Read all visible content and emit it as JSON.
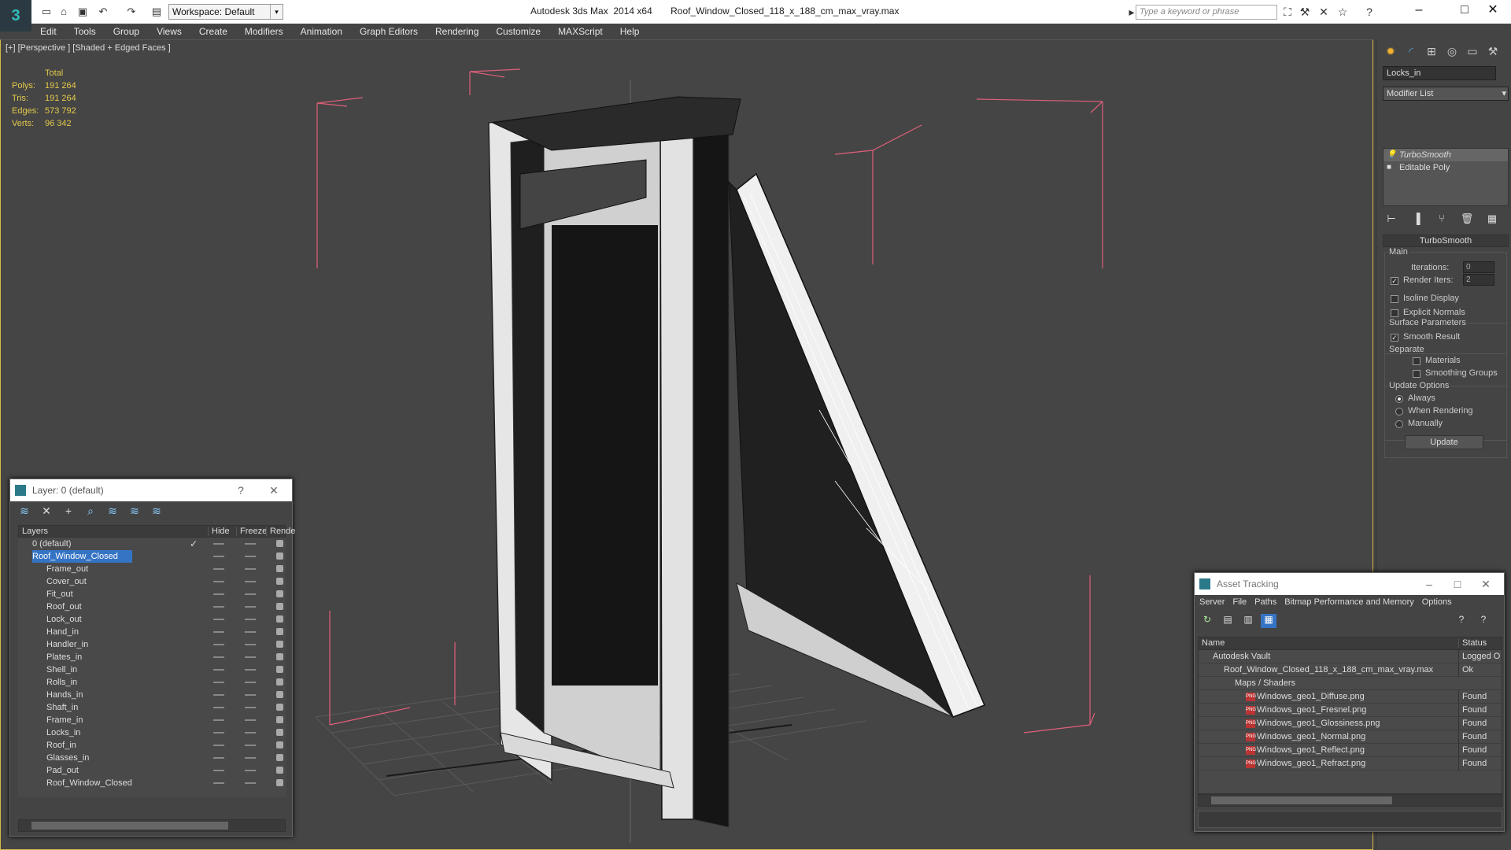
{
  "window": {
    "title": "Autodesk 3ds Max  2014 x64       Roof_Window_Closed_118_x_188_cm_max_vray.max",
    "workspace": "Workspace: Default",
    "search_placeholder": "Type a keyword or phrase"
  },
  "menu": [
    "Edit",
    "Tools",
    "Group",
    "Views",
    "Create",
    "Modifiers",
    "Animation",
    "Graph Editors",
    "Rendering",
    "Customize",
    "MAXScript",
    "Help"
  ],
  "viewport": {
    "label": "[+] [Perspective ] [Shaded + Edged Faces ]",
    "stats_header": "Total",
    "stats": [
      {
        "label": "Polys:",
        "value": "191 264"
      },
      {
        "label": "Tris:",
        "value": "191 264"
      },
      {
        "label": "Edges:",
        "value": "573 792"
      },
      {
        "label": "Verts:",
        "value": "96 342"
      }
    ]
  },
  "command_panel": {
    "object_name": "Locks_in",
    "modifier_list": "Modifier List",
    "stack": [
      "TurboSmooth",
      "Editable Poly"
    ],
    "rollout_title": "TurboSmooth",
    "main_label": "Main",
    "iterations_label": "Iterations:",
    "iterations_value": "0",
    "render_iters_label": "Render Iters:",
    "render_iters_value": "2",
    "isoline": "Isoline Display",
    "explicit": "Explicit Normals",
    "surface_params": "Surface Parameters",
    "smooth_result": "Smooth Result",
    "separate": "Separate",
    "materials": "Materials",
    "smoothing_groups": "Smoothing Groups",
    "update_options": "Update Options",
    "always": "Always",
    "when_rendering": "When Rendering",
    "manually": "Manually",
    "update_btn": "Update"
  },
  "layer_dialog": {
    "title": "Layer: 0 (default)",
    "help": "?",
    "columns": {
      "layers": "Layers",
      "hide": "Hide",
      "freeze": "Freeze",
      "render": "Rende"
    },
    "rows": [
      {
        "name": "0 (default)",
        "indent": 0
      },
      {
        "name": "Roof_Window_Closed",
        "indent": 0
      },
      {
        "name": "Frame_out",
        "indent": 1
      },
      {
        "name": "Cover_out",
        "indent": 1
      },
      {
        "name": "Fit_out",
        "indent": 1
      },
      {
        "name": "Roof_out",
        "indent": 1
      },
      {
        "name": "Lock_out",
        "indent": 1
      },
      {
        "name": "Hand_in",
        "indent": 1
      },
      {
        "name": "Handler_in",
        "indent": 1
      },
      {
        "name": "Plates_in",
        "indent": 1
      },
      {
        "name": "Shell_in",
        "indent": 1
      },
      {
        "name": "Rolls_in",
        "indent": 1
      },
      {
        "name": "Hands_in",
        "indent": 1
      },
      {
        "name": "Shaft_in",
        "indent": 1
      },
      {
        "name": "Frame_in",
        "indent": 1
      },
      {
        "name": "Locks_in",
        "indent": 1
      },
      {
        "name": "Roof_in",
        "indent": 1
      },
      {
        "name": "Glasses_in",
        "indent": 1
      },
      {
        "name": "Pad_out",
        "indent": 1
      },
      {
        "name": "Roof_Window_Closed",
        "indent": 1
      }
    ]
  },
  "asset_dialog": {
    "title": "Asset Tracking",
    "menu": [
      "Server",
      "File",
      "Paths",
      "Bitmap Performance and Memory",
      "Options"
    ],
    "columns": {
      "name": "Name",
      "status": "Status"
    },
    "rows": [
      {
        "name": "Autodesk Vault",
        "status": "Logged O",
        "indent": 1
      },
      {
        "name": "Roof_Window_Closed_118_x_188_cm_max_vray.max",
        "status": "Ok",
        "indent": 2
      },
      {
        "name": "Maps / Shaders",
        "status": "",
        "indent": 3
      },
      {
        "name": "Windows_geo1_Diffuse.png",
        "status": "Found",
        "indent": 4
      },
      {
        "name": "Windows_geo1_Fresnel.png",
        "status": "Found",
        "indent": 4
      },
      {
        "name": "Windows_geo1_Glossiness.png",
        "status": "Found",
        "indent": 4
      },
      {
        "name": "Windows_geo1_Normal.png",
        "status": "Found",
        "indent": 4
      },
      {
        "name": "Windows_geo1_Reflect.png",
        "status": "Found",
        "indent": 4
      },
      {
        "name": "Windows_geo1_Refract.png",
        "status": "Found",
        "indent": 4
      }
    ]
  },
  "colors": {
    "accent": "#d4b84a",
    "selection": "#3574c4",
    "bbox": "#e0607a"
  }
}
